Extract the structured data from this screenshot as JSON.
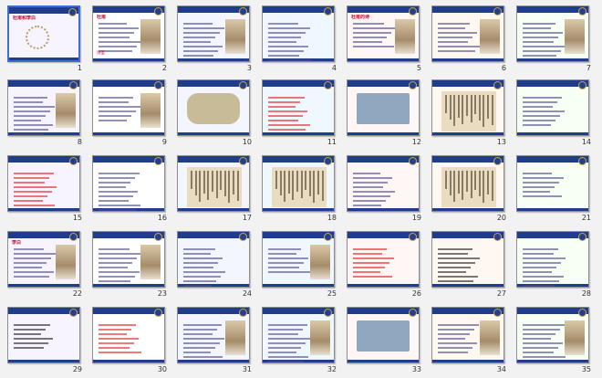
{
  "slides": [
    {
      "num": "1",
      "title": "杜甫和李白",
      "style": "title"
    },
    {
      "num": "2",
      "title": "杜甫",
      "caption": "诗圣",
      "style": "portrait"
    },
    {
      "num": "3",
      "title": "",
      "style": "figure"
    },
    {
      "num": "4",
      "title": "",
      "style": "text"
    },
    {
      "num": "5",
      "title": "杜甫的诗",
      "style": "figure"
    },
    {
      "num": "6",
      "title": "",
      "style": "figure"
    },
    {
      "num": "7",
      "title": "",
      "style": "figure"
    },
    {
      "num": "8",
      "title": "",
      "style": "text-figure"
    },
    {
      "num": "9",
      "title": "",
      "style": "text-figure"
    },
    {
      "num": "10",
      "title": "",
      "style": "stone"
    },
    {
      "num": "11",
      "title": "",
      "style": "text-red"
    },
    {
      "num": "12",
      "title": "",
      "style": "photo"
    },
    {
      "num": "13",
      "title": "",
      "style": "manuscript"
    },
    {
      "num": "14",
      "title": "",
      "style": "text"
    },
    {
      "num": "15",
      "title": "",
      "style": "text-red"
    },
    {
      "num": "16",
      "title": "",
      "style": "text"
    },
    {
      "num": "17",
      "title": "",
      "style": "manuscript"
    },
    {
      "num": "18",
      "title": "",
      "style": "manuscript"
    },
    {
      "num": "19",
      "title": "",
      "style": "text"
    },
    {
      "num": "20",
      "title": "",
      "style": "text-manuscript"
    },
    {
      "num": "21",
      "title": "",
      "style": "text"
    },
    {
      "num": "22",
      "title": "李白",
      "style": "portrait"
    },
    {
      "num": "23",
      "title": "",
      "style": "text-figure"
    },
    {
      "num": "24",
      "title": "",
      "style": "text"
    },
    {
      "num": "25",
      "title": "",
      "style": "text-figure"
    },
    {
      "num": "26",
      "title": "",
      "style": "text-red"
    },
    {
      "num": "27",
      "title": "",
      "style": "text-black"
    },
    {
      "num": "28",
      "title": "",
      "style": "text"
    },
    {
      "num": "29",
      "title": "",
      "style": "text-black"
    },
    {
      "num": "30",
      "title": "",
      "style": "text-red"
    },
    {
      "num": "31",
      "title": "",
      "style": "text-figure"
    },
    {
      "num": "32",
      "title": "",
      "style": "text-figure"
    },
    {
      "num": "33",
      "title": "",
      "style": "photo"
    },
    {
      "num": "34",
      "title": "",
      "style": "text-figure"
    },
    {
      "num": "35",
      "title": "",
      "style": "text-figure"
    }
  ],
  "selected_slide": "1",
  "colors": {
    "band": "#1f3d8a",
    "selection": "#3d6fd0",
    "title_red": "#c8102e"
  }
}
